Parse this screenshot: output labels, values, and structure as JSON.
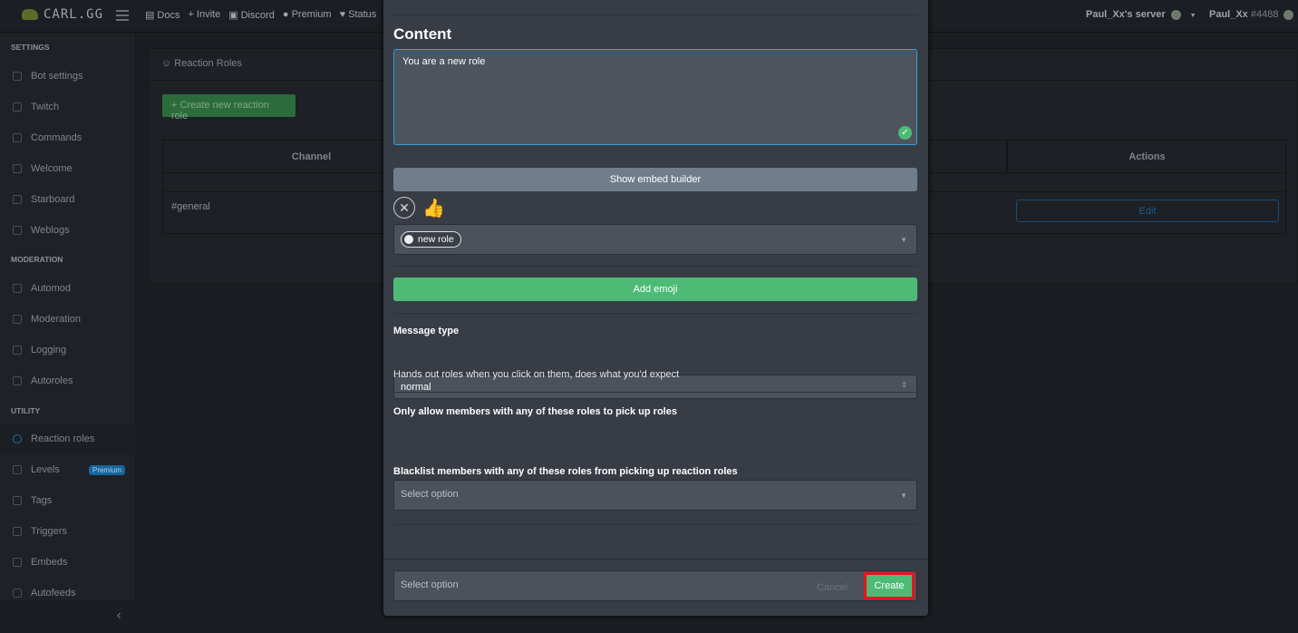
{
  "topbar": {
    "logo": "CARL.GG",
    "nav": [
      {
        "icon": "book-icon",
        "label": "Docs"
      },
      {
        "icon": "plus-icon",
        "label": "Invite"
      },
      {
        "icon": "discord-icon",
        "label": "Discord"
      },
      {
        "icon": "patreon-icon",
        "label": "Premium"
      },
      {
        "icon": "heart-icon",
        "label": "Status"
      }
    ],
    "server": "Paul_Xx's server",
    "user": "Paul_Xx",
    "discriminator": "#4488"
  },
  "sidebar": {
    "sections": [
      {
        "title": "SETTINGS",
        "items": [
          "Bot settings",
          "Twitch",
          "Commands",
          "Welcome",
          "Starboard",
          "Weblogs"
        ]
      },
      {
        "title": "MODERATION",
        "items": [
          "Automod",
          "Moderation",
          "Logging",
          "Autoroles"
        ]
      },
      {
        "title": "UTILITY",
        "items": [
          "Reaction roles",
          "Levels",
          "Tags",
          "Triggers",
          "Embeds",
          "Autofeeds"
        ]
      }
    ],
    "active": "Reaction roles",
    "premium_badge": "Premium"
  },
  "main": {
    "title": "Reaction Roles",
    "create_button": "Create new reaction role",
    "table": {
      "headers": [
        "Channel",
        "Actions"
      ],
      "rows": [
        {
          "channel": "#general",
          "action": "Edit"
        }
      ]
    }
  },
  "modal": {
    "content_label": "Content",
    "content_value": "You are a new role",
    "embed_builder": "Show embed builder",
    "emoji": "👍",
    "role": "new role",
    "add_emoji": "Add emoji",
    "message_type_label": "Message type",
    "message_type_value": "normal",
    "message_type_help": "Hands out roles when you click on them, does what you'd expect",
    "allow_label": "Only allow members with any of these roles to pick up roles",
    "allow_placeholder": "Select option",
    "blacklist_label": "Blacklist members with any of these roles from picking up reaction roles",
    "blacklist_placeholder": "Select option",
    "cancel": "Cancel",
    "create": "Create"
  },
  "colors": {
    "accent_green": "#4dbb76",
    "highlight": "#e8141c",
    "link_blue": "#1c5a8e"
  }
}
